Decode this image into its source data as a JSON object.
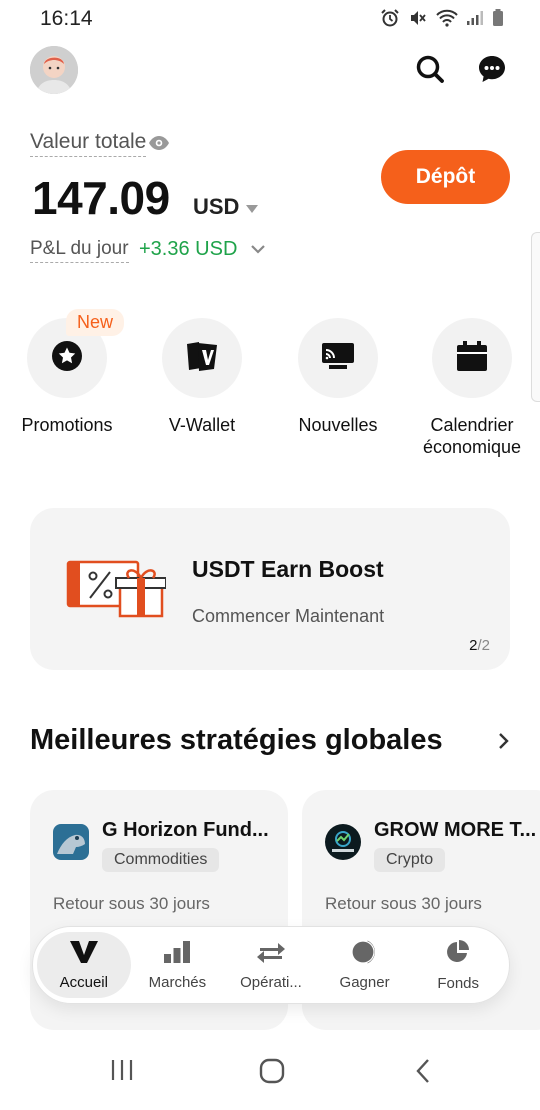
{
  "status_bar": {
    "time": "16:14"
  },
  "balance": {
    "label": "Valeur totale",
    "amount": "147.09",
    "currency": "USD",
    "pnl_label": "P&L du jour",
    "pnl_value": "+3.36 USD",
    "deposit_label": "Dépôt"
  },
  "shortcuts": [
    {
      "label": "Promotions",
      "badge": "New",
      "icon": "star-icon"
    },
    {
      "label": "V-Wallet",
      "icon": "wallet-icon"
    },
    {
      "label": "Nouvelles",
      "icon": "news-icon"
    },
    {
      "label_line1": "Calendrier",
      "label_line2": "économique",
      "icon": "calendar-icon"
    }
  ],
  "banner": {
    "title": "USDT Earn Boost",
    "subtitle": "Commencer Maintenant",
    "page_current": "2",
    "page_total": "/2"
  },
  "section": {
    "title": "Meilleures stratégies globales"
  },
  "strategies": [
    {
      "name": "G Horizon Fund...",
      "tag": "Commodities",
      "return_label": "Retour sous 30 jours"
    },
    {
      "name": "GROW MORE T...",
      "tag": "Crypto",
      "return_label": "Retour sous 30 jours"
    }
  ],
  "bottom_nav": [
    {
      "label": "Accueil",
      "active": true
    },
    {
      "label": "Marchés"
    },
    {
      "label": "Opérati..."
    },
    {
      "label": "Gagner"
    },
    {
      "label": "Fonds"
    }
  ],
  "colors": {
    "accent": "#f5601b",
    "positive": "#1fa34a"
  }
}
